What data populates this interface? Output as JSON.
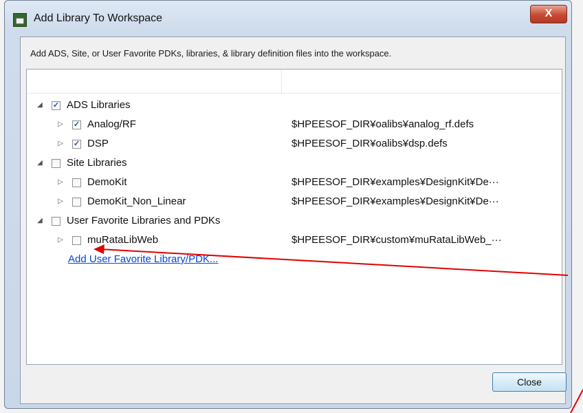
{
  "window": {
    "title": "Add Library To Workspace",
    "close_glyph": "X"
  },
  "description": "Add ADS, Site, or User Favorite PDKs, libraries, & library definition files into the workspace.",
  "groups": [
    {
      "label": "ADS Libraries",
      "checked": true,
      "expanded": true,
      "items": [
        {
          "label": "Analog/RF",
          "checked": true,
          "path": "$HPEESOF_DIR¥oalibs¥analog_rf.defs"
        },
        {
          "label": "DSP",
          "checked": true,
          "path": "$HPEESOF_DIR¥oalibs¥dsp.defs"
        }
      ]
    },
    {
      "label": "Site Libraries",
      "checked": false,
      "expanded": true,
      "items": [
        {
          "label": "DemoKit",
          "checked": false,
          "path": "$HPEESOF_DIR¥examples¥DesignKit¥De···"
        },
        {
          "label": "DemoKit_Non_Linear",
          "checked": false,
          "path": "$HPEESOF_DIR¥examples¥DesignKit¥De···"
        }
      ]
    },
    {
      "label": "User Favorite Libraries and PDKs",
      "checked": false,
      "expanded": true,
      "items": [
        {
          "label": "muRataLibWeb",
          "checked": false,
          "path": "$HPEESOF_DIR¥custom¥muRataLibWeb_···"
        }
      ]
    }
  ],
  "add_link": "Add User Favorite Library/PDK...",
  "close_button": "Close",
  "icons": {
    "group_expander": "triangle-down-icon",
    "item_expander": "triangle-right-icon",
    "check": "checkmark-icon"
  },
  "colors": {
    "link": "#0645d6",
    "annotation_arrow": "#e00000"
  }
}
